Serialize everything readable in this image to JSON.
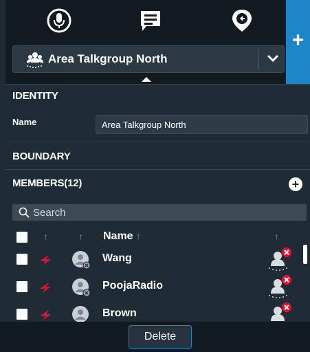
{
  "toolbar": {
    "icons": [
      "microphone-icon",
      "message-icon",
      "location-pin-icon"
    ],
    "add_label": "+"
  },
  "talkgroup": {
    "icon": "group-icon",
    "selected": "Area Talkgroup North"
  },
  "identity": {
    "heading": "IDENTITY",
    "name_label": "Name",
    "name_value": "Area Talkgroup North"
  },
  "boundary": {
    "heading": "BOUNDARY"
  },
  "members": {
    "heading": "MEMBERS(12)",
    "search_placeholder": "Search",
    "column_name": "Name",
    "rows": [
      {
        "name": "Wang"
      },
      {
        "name": "PoojaRadio"
      },
      {
        "name": "Brown"
      }
    ]
  },
  "footer": {
    "delete_label": "Delete"
  },
  "colors": {
    "background": "#1f2b35",
    "toolbar": "#121a21",
    "accent": "#1b87c8",
    "radio_red": "#e8102e"
  }
}
